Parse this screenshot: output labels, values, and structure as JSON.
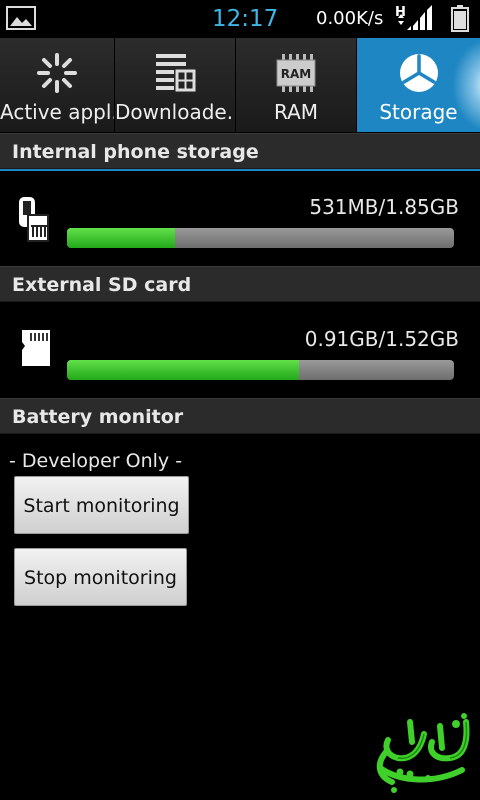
{
  "status_bar": {
    "time": "12:17",
    "net_speed": "0.00K/s",
    "network_type": "H",
    "icons": [
      "gallery-icon",
      "signal-icon",
      "battery-icon"
    ]
  },
  "tabs": [
    {
      "label": "Active appl..",
      "icon": "loading-spinner-icon",
      "active": false
    },
    {
      "label": "Downloade..",
      "icon": "downloaded-apps-icon",
      "active": false
    },
    {
      "label": "RAM",
      "icon": "ram-chip-icon",
      "icon_text": "RAM",
      "active": false
    },
    {
      "label": "Storage",
      "icon": "pie-chart-icon",
      "active": true
    }
  ],
  "internal": {
    "header": "Internal phone storage",
    "value": "531MB/1.85GB",
    "used_fraction": 0.28,
    "icon": "phone-memory-icon"
  },
  "external": {
    "header": "External SD card",
    "value": "0.91GB/1.52GB",
    "used_fraction": 0.6,
    "icon": "sd-card-icon"
  },
  "battery": {
    "header": "Battery monitor",
    "note": "- Developer Only -",
    "start_label": "Start monitoring",
    "stop_label": "Stop monitoring"
  },
  "colors": {
    "accent": "#1e86c2",
    "bar_fill": "#3cc42c",
    "time": "#3fb6e6"
  }
}
